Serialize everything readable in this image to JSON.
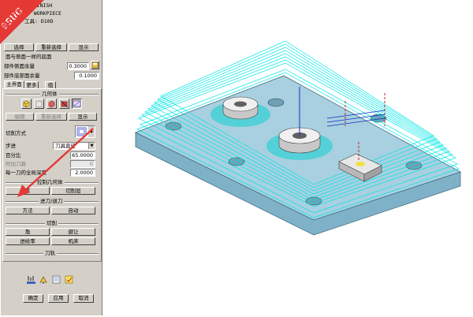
{
  "dialog": {
    "header_lines": [
      "LE_FINISH",
      "L: WORKPIECE",
      "工具: D10D"
    ],
    "buttons_row1": {
      "select": "选择",
      "reselect": "重新选择",
      "display": "显示"
    },
    "same_floor_label": "面与侧面一样的底面",
    "side_stock_label": "部件侧面余量",
    "side_stock_value": "0.3000",
    "floor_stock_label": "部件底部面余量",
    "floor_stock_value": "0.1000",
    "tabs": [
      "主界面",
      "更多",
      "组"
    ],
    "geometry_title": "几何体",
    "geom_buttons": {
      "edit": "编辑",
      "reselect": "重新选择",
      "display": "显示"
    },
    "cut_pattern_label": "切削方式",
    "stepover_label": "步进",
    "stepover_value": "刀具直径",
    "percent_label": "百分比",
    "percent_value": "65.0000",
    "extra_passes_label": "附加刀路",
    "extra_passes_value": "0",
    "depth_label": "每一刀的全局深度",
    "depth_value": "2.0000",
    "control_geom_title": "控制几何体",
    "control_buttons": {
      "point": "点",
      "cut_levels": "切削层"
    },
    "engage_title": "进刀/退刀",
    "engage_buttons": {
      "method": "方法",
      "auto": "自动"
    },
    "cutting_title": "切削",
    "cutting_buttons": {
      "corner": "角",
      "avoid": "避让",
      "feeds": "进给率",
      "machine": "机床"
    },
    "toolpath_title": "刀轨",
    "footer_buttons": {
      "ok": "确定",
      "apply": "应用",
      "cancel": "取消"
    }
  },
  "watermark": {
    "line1": "9SUG",
    "line2": "学UG就上UG网"
  },
  "colors": {
    "panel": "#d4d0c8",
    "toolpath": "#00e5e5",
    "part_face": "#a8d0e0",
    "part_side": "#7fb2c8",
    "watermark": "#e53935"
  }
}
